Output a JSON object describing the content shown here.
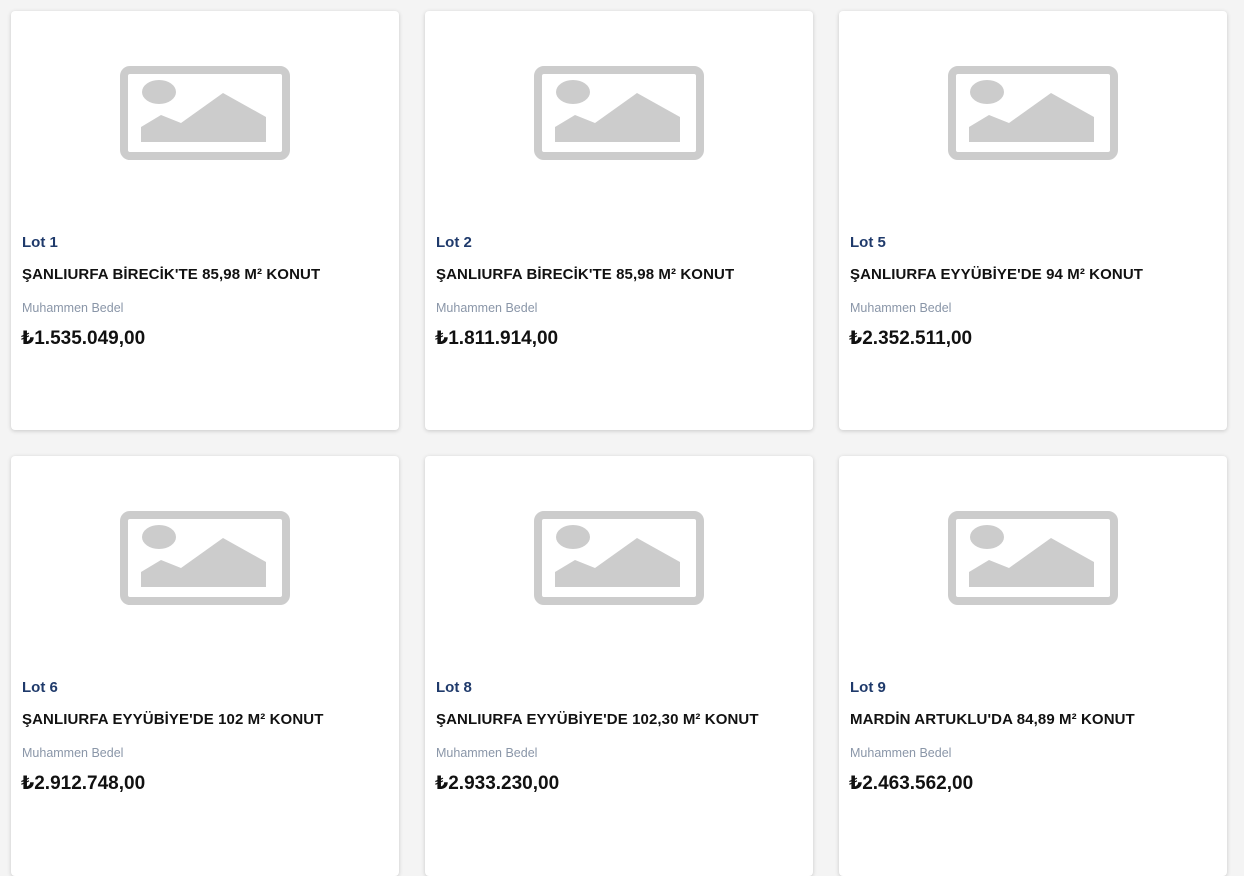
{
  "placeholder_icon": "image-placeholder-icon",
  "colors": {
    "background": "#f4f4f4",
    "card": "#ffffff",
    "lot_text": "#1f3a6b",
    "label_text": "#8a96a8",
    "placeholder_gray": "#cccccc"
  },
  "lots": [
    {
      "lot": "Lot 1",
      "title": "ŞANLIURFA BİRECİK'TE 85,98 M² KONUT",
      "price_label": "Muhammen Bedel",
      "price": "₺1.535.049,00"
    },
    {
      "lot": "Lot 2",
      "title": "ŞANLIURFA BİRECİK'TE 85,98 M² KONUT",
      "price_label": "Muhammen Bedel",
      "price": "₺1.811.914,00"
    },
    {
      "lot": "Lot 5",
      "title": "ŞANLIURFA EYYÜBİYE'DE 94 M² KONUT",
      "price_label": "Muhammen Bedel",
      "price": "₺2.352.511,00"
    },
    {
      "lot": "Lot 6",
      "title": "ŞANLIURFA EYYÜBİYE'DE 102 M² KONUT",
      "price_label": "Muhammen Bedel",
      "price": "₺2.912.748,00"
    },
    {
      "lot": "Lot 8",
      "title": "ŞANLIURFA EYYÜBİYE'DE 102,30 M² KONUT",
      "price_label": "Muhammen Bedel",
      "price": "₺2.933.230,00"
    },
    {
      "lot": "Lot 9",
      "title": "MARDİN ARTUKLU'DA 84,89 M² KONUT",
      "price_label": "Muhammen Bedel",
      "price": "₺2.463.562,00"
    }
  ]
}
